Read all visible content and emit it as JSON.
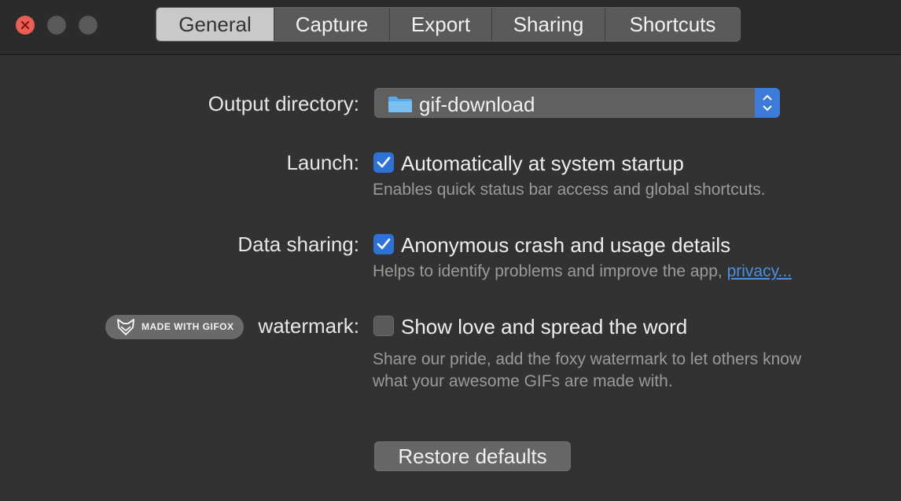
{
  "window": {
    "tabs": [
      {
        "label": "General",
        "active": true
      },
      {
        "label": "Capture",
        "active": false
      },
      {
        "label": "Export",
        "active": false
      },
      {
        "label": "Sharing",
        "active": false
      },
      {
        "label": "Shortcuts",
        "active": false
      }
    ]
  },
  "output": {
    "label": "Output directory:",
    "value": "gif-download",
    "icon": "folder-icon"
  },
  "launch": {
    "label": "Launch:",
    "checkbox_label": "Automatically at system startup",
    "checked": true,
    "hint": "Enables quick status bar access and global shortcuts."
  },
  "data_sharing": {
    "label": "Data sharing:",
    "checkbox_label": "Anonymous crash and usage details",
    "checked": true,
    "hint": "Helps to identify problems and improve the app,",
    "link": "privacy..."
  },
  "watermark": {
    "badge": "MADE WITH GIFOX",
    "label": "watermark:",
    "checkbox_label": "Show love and spread the word",
    "checked": false,
    "hint_line1": "Share our pride, add the foxy watermark to let others know",
    "hint_line2": "what your awesome GIFs are made with."
  },
  "actions": {
    "restore": "Restore defaults"
  },
  "colors": {
    "accent": "#2f72d6",
    "close": "#ec5f57",
    "link": "#4a90e2"
  }
}
